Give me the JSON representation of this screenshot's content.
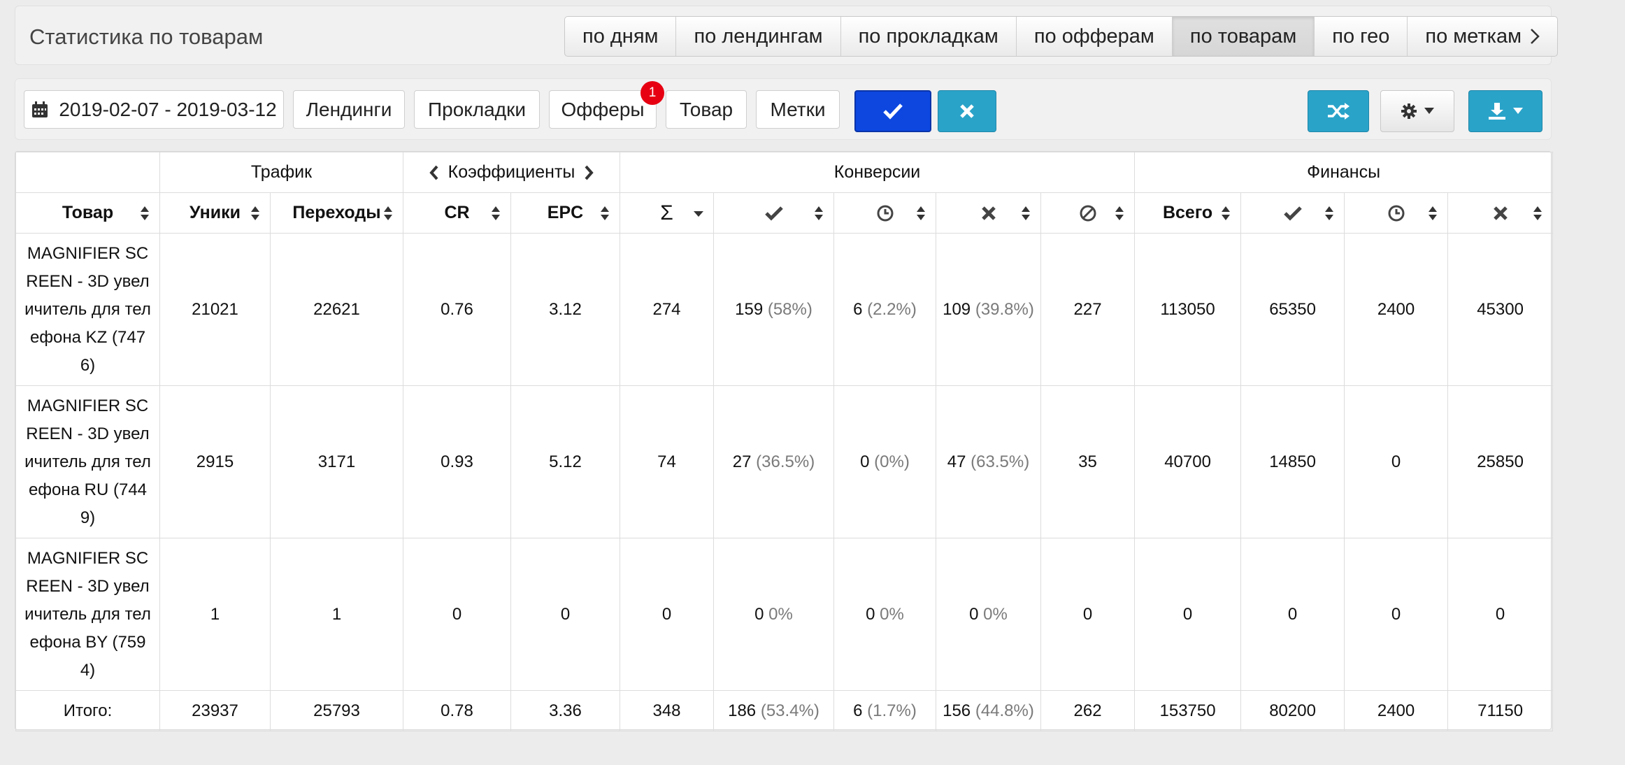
{
  "header": {
    "title": "Статистика по товарам",
    "tabs": [
      {
        "label": "по дням"
      },
      {
        "label": "по лендингам"
      },
      {
        "label": "по прокладкам"
      },
      {
        "label": "по офферам"
      },
      {
        "label": "по товарам",
        "active": true
      },
      {
        "label": "по гео"
      },
      {
        "label": "по меткам"
      }
    ]
  },
  "filters": {
    "date_range": "2019-02-07 - 2019-03-12",
    "landings": "Лендинги",
    "prelandings": "Прокладки",
    "offers": "Офферы",
    "offers_badge": "1",
    "product": "Товар",
    "tags": "Метки"
  },
  "icons": {
    "calendar": "calendar-icon",
    "apply": "check-icon",
    "reset": "close-icon",
    "shuffle": "shuffle-icon",
    "settings": "gear-icon",
    "download": "download-icon"
  },
  "colors": {
    "apply_button": "#0d47e0",
    "reset_button": "#2aa3c9",
    "shuffle_button": "#2aa3c9",
    "download_button": "#2aa3c9",
    "badge": "#e60012"
  },
  "table": {
    "groups": {
      "traffic": "Трафик",
      "coefficients": "Коэффициенты",
      "conversions": "Конверсии",
      "finances": "Финансы"
    },
    "columns": {
      "product": "Товар",
      "uniques": "Уники",
      "clicks": "Переходы",
      "cr": "CR",
      "epc": "EPC",
      "sum_icon": "Σ",
      "finance_total": "Всего"
    },
    "rows": [
      {
        "name": "MAGNIFIER SCREEN - 3D увеличитель для телефона KZ (7476)",
        "uniques": "21021",
        "clicks": "22621",
        "cr": "0.76",
        "epc": "3.12",
        "conv_total": "274",
        "approved": "159",
        "approved_pct": "(58%)",
        "pending": "6",
        "pending_pct": "(2.2%)",
        "rejected": "109",
        "rejected_pct": "(39.8%)",
        "trash": "227",
        "fin_total": "113050",
        "fin_approved": "65350",
        "fin_pending": "2400",
        "fin_rejected": "45300"
      },
      {
        "name": "MAGNIFIER SCREEN - 3D увеличитель для телефона RU (7449)",
        "uniques": "2915",
        "clicks": "3171",
        "cr": "0.93",
        "epc": "5.12",
        "conv_total": "74",
        "approved": "27",
        "approved_pct": "(36.5%)",
        "pending": "0",
        "pending_pct": "(0%)",
        "rejected": "47",
        "rejected_pct": "(63.5%)",
        "trash": "35",
        "fin_total": "40700",
        "fin_approved": "14850",
        "fin_pending": "0",
        "fin_rejected": "25850"
      },
      {
        "name": "MAGNIFIER SCREEN - 3D увеличитель для телефона BY (7594)",
        "uniques": "1",
        "clicks": "1",
        "cr": "0",
        "epc": "0",
        "conv_total": "0",
        "approved": "0",
        "approved_pct": "0%",
        "pending": "0",
        "pending_pct": "0%",
        "rejected": "0",
        "rejected_pct": "0%",
        "trash": "0",
        "fin_total": "0",
        "fin_approved": "0",
        "fin_pending": "0",
        "fin_rejected": "0"
      }
    ],
    "total": {
      "label": "Итого:",
      "uniques": "23937",
      "clicks": "25793",
      "cr": "0.78",
      "epc": "3.36",
      "conv_total": "348",
      "approved": "186",
      "approved_pct": "(53.4%)",
      "pending": "6",
      "pending_pct": "(1.7%)",
      "rejected": "156",
      "rejected_pct": "(44.8%)",
      "trash": "262",
      "fin_total": "153750",
      "fin_approved": "80200",
      "fin_pending": "2400",
      "fin_rejected": "71150"
    }
  }
}
